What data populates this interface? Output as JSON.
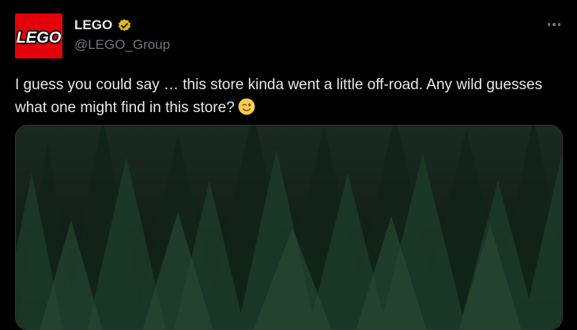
{
  "post": {
    "author": {
      "display_name": "LEGO",
      "handle": "@LEGO_Group",
      "verified": true,
      "avatar_icon": "lego-logo-icon",
      "avatar_logo_text": "LEGO",
      "avatar_color": "#e3000b",
      "badge_color": "#e2b719"
    },
    "more_icon": "more-dots-icon",
    "text": "I guess you could say … this store kinda went a little off-road. Any wild guesses what one might find in this store?",
    "emoji": "winking-face-emoji",
    "media": {
      "type": "image",
      "description_icon": "pine-forest-image"
    }
  },
  "colors": {
    "background": "#000000",
    "primary_text": "#e7e9ea",
    "secondary_text": "#71767b"
  }
}
